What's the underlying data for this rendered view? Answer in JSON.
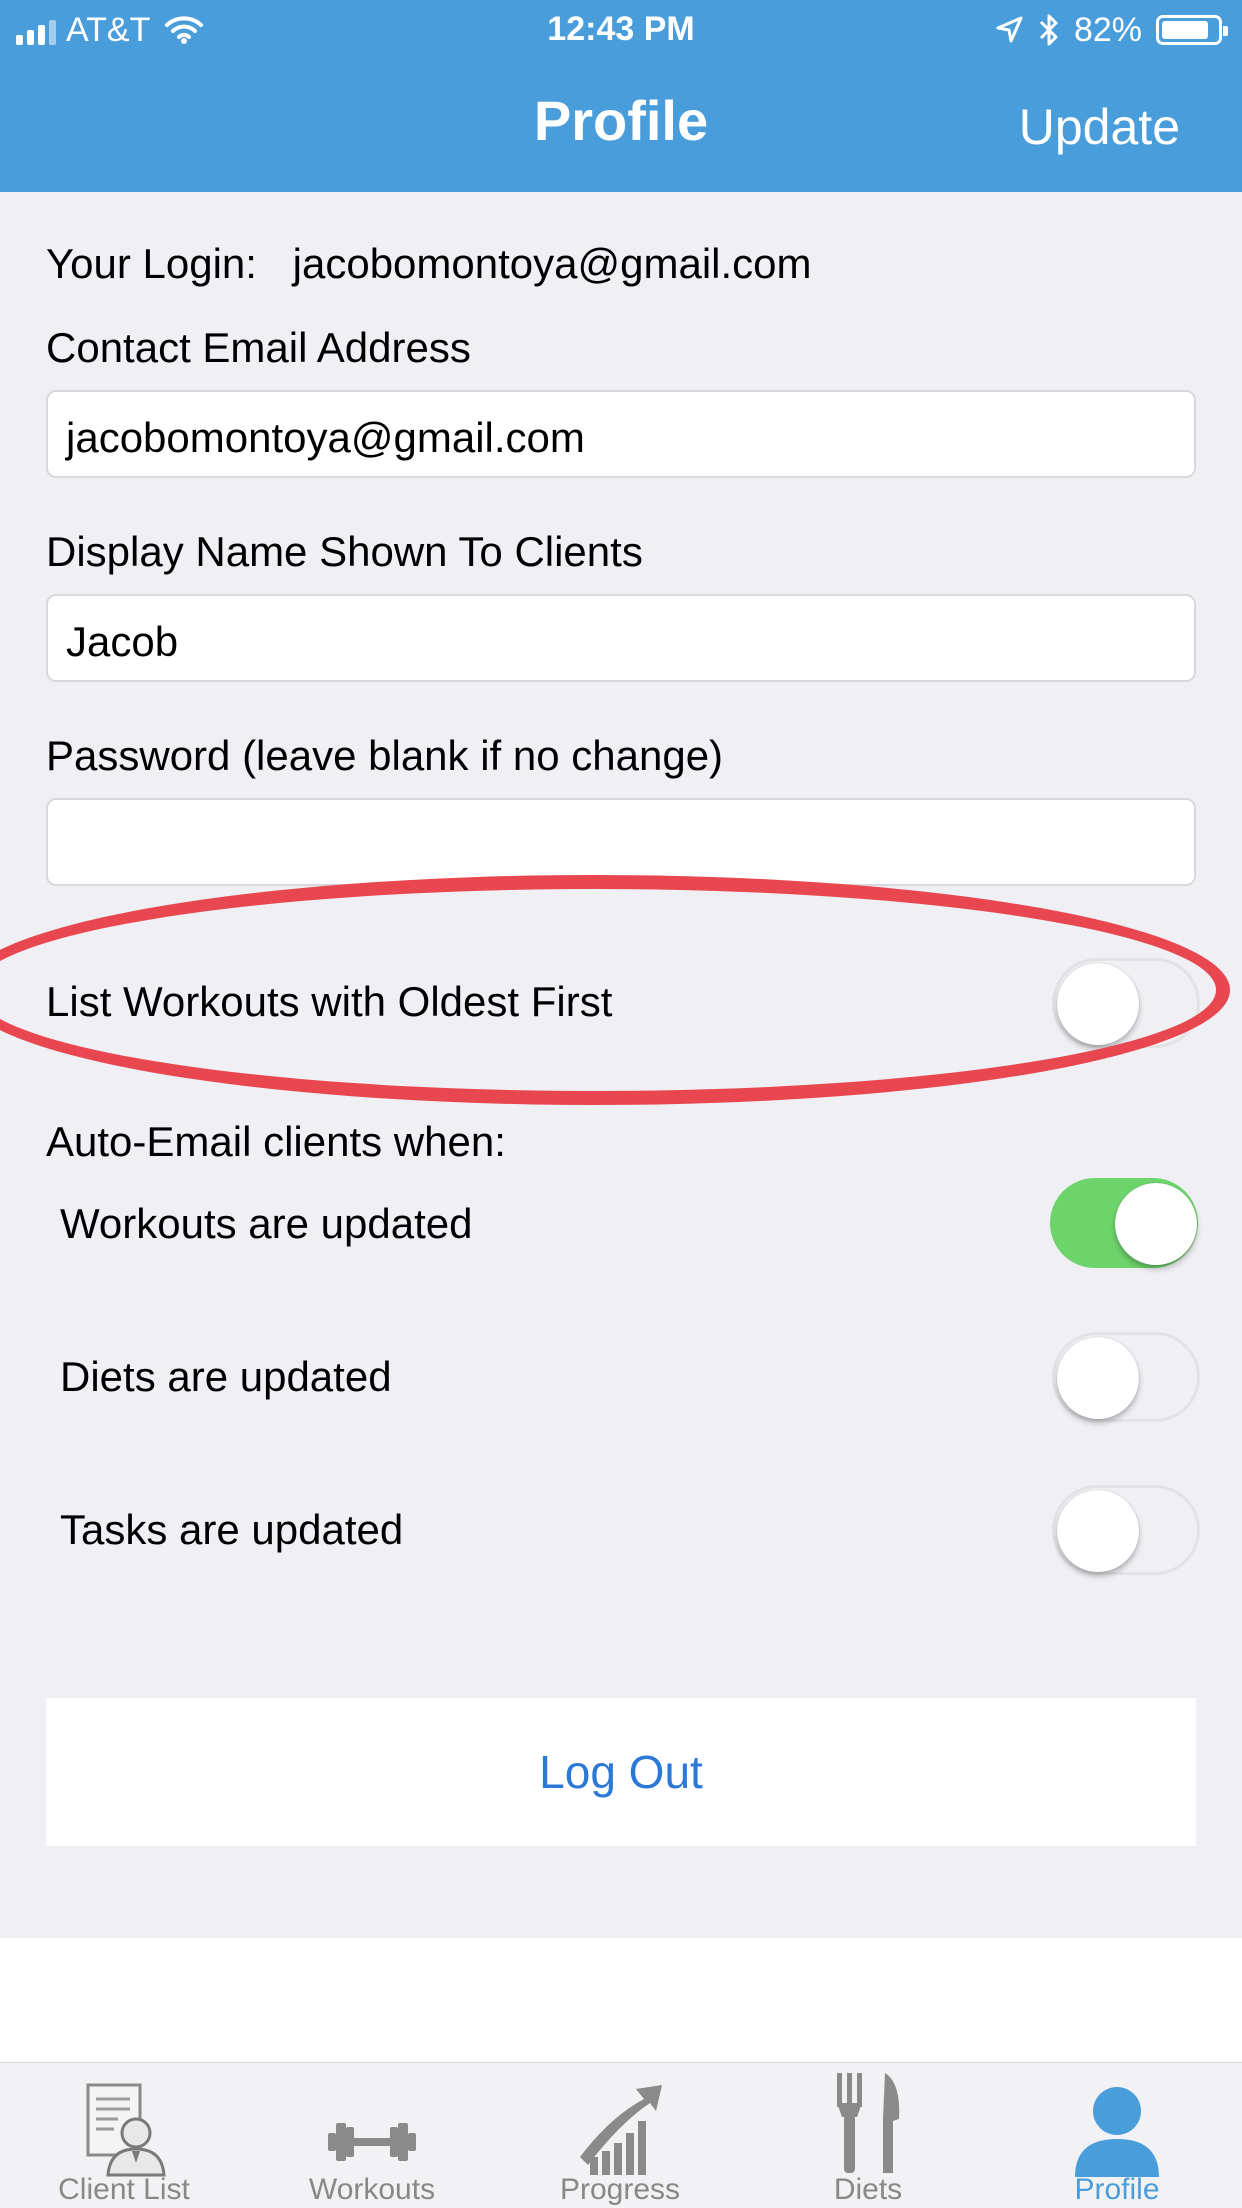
{
  "status_bar": {
    "carrier": "AT&T",
    "time": "12:43 PM",
    "battery": "82%"
  },
  "nav": {
    "title": "Profile",
    "action": "Update"
  },
  "form": {
    "login_label": "Your Login:",
    "login_value": "jacobomontoya@gmail.com",
    "contact_email_label": "Contact Email Address",
    "contact_email_value": "jacobomontoya@gmail.com",
    "display_name_label": "Display Name Shown To Clients",
    "display_name_value": "Jacob",
    "password_label": "Password (leave blank if no change)",
    "password_value": "",
    "oldest_first_label": "List Workouts with Oldest First",
    "oldest_first_on": false,
    "auto_email_heading": "Auto-Email clients when:",
    "auto_email": [
      {
        "label": "Workouts are updated",
        "on": true
      },
      {
        "label": "Diets are updated",
        "on": false
      },
      {
        "label": "Tasks are updated",
        "on": false
      }
    ],
    "logout_label": "Log Out"
  },
  "tabs": [
    {
      "label": "Client List",
      "icon": "client-list-icon",
      "active": false
    },
    {
      "label": "Workouts",
      "icon": "dumbbell-icon",
      "active": false
    },
    {
      "label": "Progress",
      "icon": "progress-chart-icon",
      "active": false
    },
    {
      "label": "Diets",
      "icon": "fork-knife-icon",
      "active": false
    },
    {
      "label": "Profile",
      "icon": "person-icon",
      "active": true
    }
  ],
  "colors": {
    "nav_bar": "#4a9ddb",
    "toggle_on": "#6dd46c",
    "highlight_ring": "#e8474f",
    "link": "#2b78d6"
  }
}
